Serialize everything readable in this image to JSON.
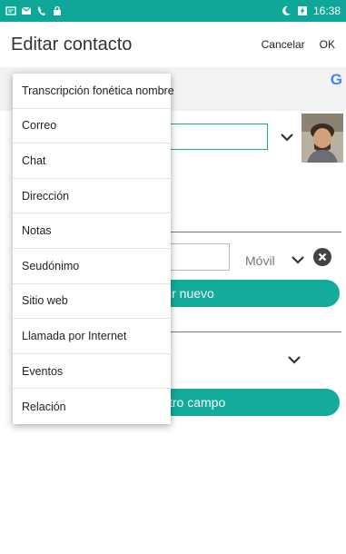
{
  "status_bar": {
    "time": "16:38"
  },
  "app_bar": {
    "title": "Editar contacto",
    "cancel_label": "Cancelar",
    "ok_label": "OK"
  },
  "account": {
    "google_mark": "G"
  },
  "phone": {
    "type_label": "Móvil"
  },
  "buttons": {
    "add_new_label": "ir nuevo",
    "other_field_label": "tro campo"
  },
  "menu": {
    "items": [
      {
        "label": "Transcripción fonética nombre"
      },
      {
        "label": "Correo"
      },
      {
        "label": "Chat"
      },
      {
        "label": "Dirección"
      },
      {
        "label": "Notas"
      },
      {
        "label": "Seudónimo"
      },
      {
        "label": "Sitio web"
      },
      {
        "label": "Llamada por Internet"
      },
      {
        "label": "Eventos"
      },
      {
        "label": "Relación"
      }
    ]
  },
  "icons": {
    "status_left": [
      "notification-icon",
      "message-icon",
      "phone-icon",
      "lock-icon"
    ],
    "status_right": [
      "moon-icon",
      "battery-charging-icon"
    ]
  },
  "colors": {
    "status_bar": "#0fa79a",
    "accent": "#12ab9c",
    "google_blue": "#4285f4"
  }
}
